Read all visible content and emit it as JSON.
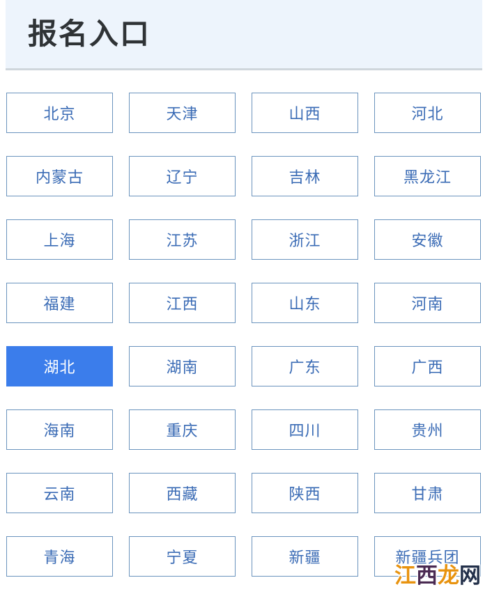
{
  "header": {
    "title": "报名入口",
    "background_color": "#edf4fc",
    "title_color": "#2f3336",
    "divider_color": "#cfd6dc"
  },
  "grid": {
    "columns": 4,
    "button_border_color": "#6a93bd",
    "button_text_color": "#3a6bb5",
    "selected_background_color": "#3b7deb",
    "selected_text_color": "#ffffff",
    "selected_label": "湖北",
    "buttons": [
      {
        "label": "北京",
        "selected": false
      },
      {
        "label": "天津",
        "selected": false
      },
      {
        "label": "山西",
        "selected": false
      },
      {
        "label": "河北",
        "selected": false
      },
      {
        "label": "内蒙古",
        "selected": false
      },
      {
        "label": "辽宁",
        "selected": false
      },
      {
        "label": "吉林",
        "selected": false
      },
      {
        "label": "黑龙江",
        "selected": false
      },
      {
        "label": "上海",
        "selected": false
      },
      {
        "label": "江苏",
        "selected": false
      },
      {
        "label": "浙江",
        "selected": false
      },
      {
        "label": "安徽",
        "selected": false
      },
      {
        "label": "福建",
        "selected": false
      },
      {
        "label": "江西",
        "selected": false
      },
      {
        "label": "山东",
        "selected": false
      },
      {
        "label": "河南",
        "selected": false
      },
      {
        "label": "湖北",
        "selected": true
      },
      {
        "label": "湖南",
        "selected": false
      },
      {
        "label": "广东",
        "selected": false
      },
      {
        "label": "广西",
        "selected": false
      },
      {
        "label": "海南",
        "selected": false
      },
      {
        "label": "重庆",
        "selected": false
      },
      {
        "label": "四川",
        "selected": false
      },
      {
        "label": "贵州",
        "selected": false
      },
      {
        "label": "云南",
        "selected": false
      },
      {
        "label": "西藏",
        "selected": false
      },
      {
        "label": "陕西",
        "selected": false
      },
      {
        "label": "甘肃",
        "selected": false
      },
      {
        "label": "青海",
        "selected": false
      },
      {
        "label": "宁夏",
        "selected": false
      },
      {
        "label": "新疆",
        "selected": false
      },
      {
        "label": "新疆兵团",
        "selected": false
      }
    ]
  },
  "watermark": {
    "chars": [
      {
        "char": "江",
        "color": "#e8930f"
      },
      {
        "char": "西",
        "color": "#4a2a52"
      },
      {
        "char": "龙",
        "color": "#e8930f"
      },
      {
        "char": "网",
        "color": "#23304a"
      }
    ],
    "text": "江西龙网"
  }
}
